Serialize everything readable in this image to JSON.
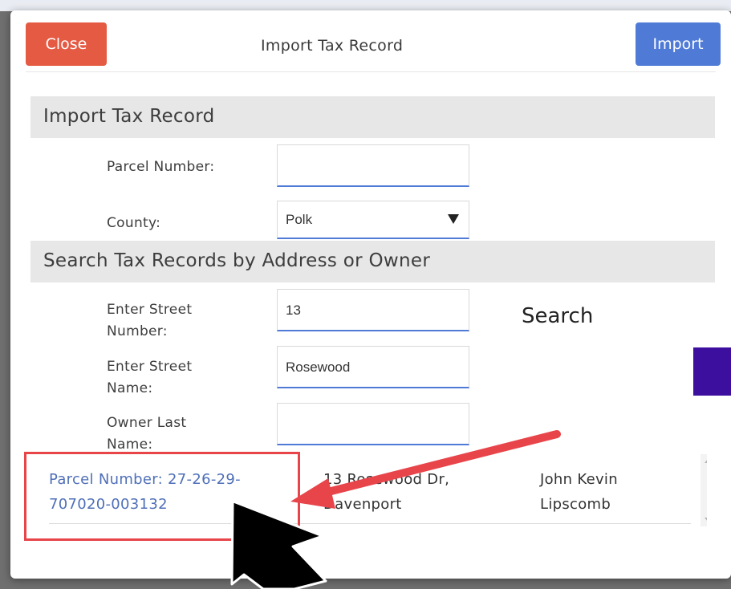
{
  "modal": {
    "title": "Import Tax Record",
    "close_label": "Close",
    "import_label": "Import"
  },
  "import_section": {
    "heading": "Import Tax Record",
    "parcel_label": "Parcel Number:",
    "parcel_value": "",
    "county_label": "County:",
    "county_value": "Polk"
  },
  "search_section": {
    "heading": "Search Tax Records by Address or Owner",
    "street_number_label_1": "Enter Street",
    "street_number_label_2": "Number:",
    "street_number_value": "13",
    "street_name_label_1": "Enter Street",
    "street_name_label_2": "Name:",
    "street_name_value": "Rosewood",
    "owner_label_1": "Owner Last",
    "owner_label_2": "Name:",
    "owner_value": "",
    "search_label": "Search"
  },
  "results": [
    {
      "parcel_line1": "Parcel Number: 27-26-29-",
      "parcel_line2": "707020-003132",
      "address_line1": "13 Rosewood Dr,",
      "address_line2": "Davenport",
      "owner_line1": "John Kevin",
      "owner_line2": "Lipscomb"
    }
  ],
  "colors": {
    "close_button": "#e45a43",
    "import_button": "#4f7ad6",
    "link": "#4f6fb8",
    "annotation": "#e8454b",
    "purple_block": "#3d0f9e"
  }
}
